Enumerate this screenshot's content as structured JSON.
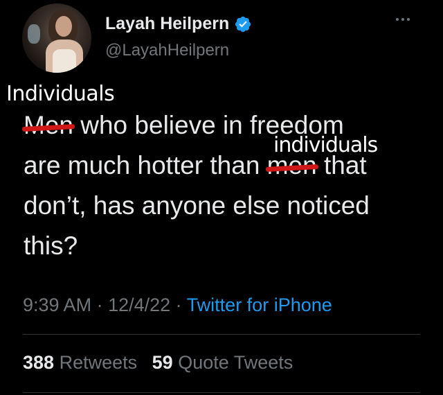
{
  "author": {
    "display_name": "Layah Heilpern",
    "handle": "@LayahHeilpern",
    "verified": true,
    "verified_color": "#1d9bf0"
  },
  "overlay_annotations": {
    "top": "Individuals",
    "middle": "individuals"
  },
  "tweet": {
    "line1_struck": "Men",
    "line1_rest": " who believe in freedom",
    "line2_start": "are much hotter than ",
    "line2_struck": "men",
    "line2_end": " that",
    "line3": "don’t, has anyone else noticed",
    "line4": "this?"
  },
  "meta": {
    "time": "9:39 AM",
    "sep1": " · ",
    "date": "12/4/22",
    "sep2": " · ",
    "source": "Twitter for iPhone"
  },
  "stats": {
    "retweets_count": "388",
    "retweets_label": " Retweets",
    "quotes_count": "59",
    "quotes_label": " Quote Tweets"
  },
  "icons": {
    "more": "more-dots-icon",
    "verified": "verified-badge-icon"
  },
  "colors": {
    "background": "#000000",
    "text": "#e7e9ea",
    "secondary": "#71767b",
    "link": "#1d9bf0",
    "strike": "#d01818"
  }
}
